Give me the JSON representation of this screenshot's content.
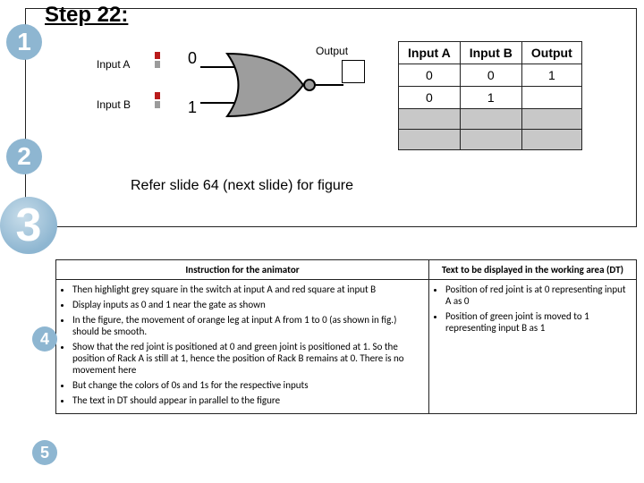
{
  "badges": {
    "b1": "1",
    "b2": "2",
    "b3": "3",
    "b4": "4",
    "b5": "5"
  },
  "step_title": "Step 22:",
  "labels": {
    "inputA": "Input A",
    "inputB": "Input B",
    "output": "Output",
    "num0": "0",
    "num1": "1"
  },
  "truth_table": {
    "headers": [
      "Input A",
      "Input B",
      "Output"
    ],
    "r1": {
      "a": "0",
      "b": "0",
      "out": "1"
    },
    "r2": {
      "a": "0",
      "b": "1",
      "out": ""
    }
  },
  "refer": "Refer slide 64 (next slide) for figure",
  "chart_data": {
    "type": "table",
    "title": "NOR-gate truth table (partial, as shown)",
    "columns": [
      "Input A",
      "Input B",
      "Output"
    ],
    "rows": [
      {
        "Input A": 0,
        "Input B": 0,
        "Output": 1
      },
      {
        "Input A": 0,
        "Input B": 1,
        "Output": null
      },
      {
        "Input A": null,
        "Input B": null,
        "Output": null
      },
      {
        "Input A": null,
        "Input B": null,
        "Output": null
      }
    ],
    "gate": {
      "type": "NOR",
      "inputs": {
        "A": 0,
        "B": 1
      }
    }
  },
  "bottom": {
    "h1": "Instruction for the animator",
    "h2": "Text to be displayed in the working area (DT)",
    "left": {
      "i1": "Then highlight grey square in the switch at input A and red square at input B",
      "i2": "Display inputs as 0 and 1 near the gate as shown",
      "i3": "In the figure, the movement of orange leg at input A from 1 to 0 (as shown in fig.) should be smooth.",
      "i4": "Show that the red joint is positioned at 0 and green joint is positioned at 1. So the position of Rack A is still at 1, hence the position of Rack B remains at 0. There is no movement here",
      "i5": "But change the colors of 0s and 1s for the respective inputs",
      "i6": "The text in DT should appear  in parallel to the figure"
    },
    "right": {
      "r1": "Position of  red joint is at 0 representing input A as 0",
      "r2": "Position of  green joint is moved to 1 representing input B as 1"
    }
  }
}
